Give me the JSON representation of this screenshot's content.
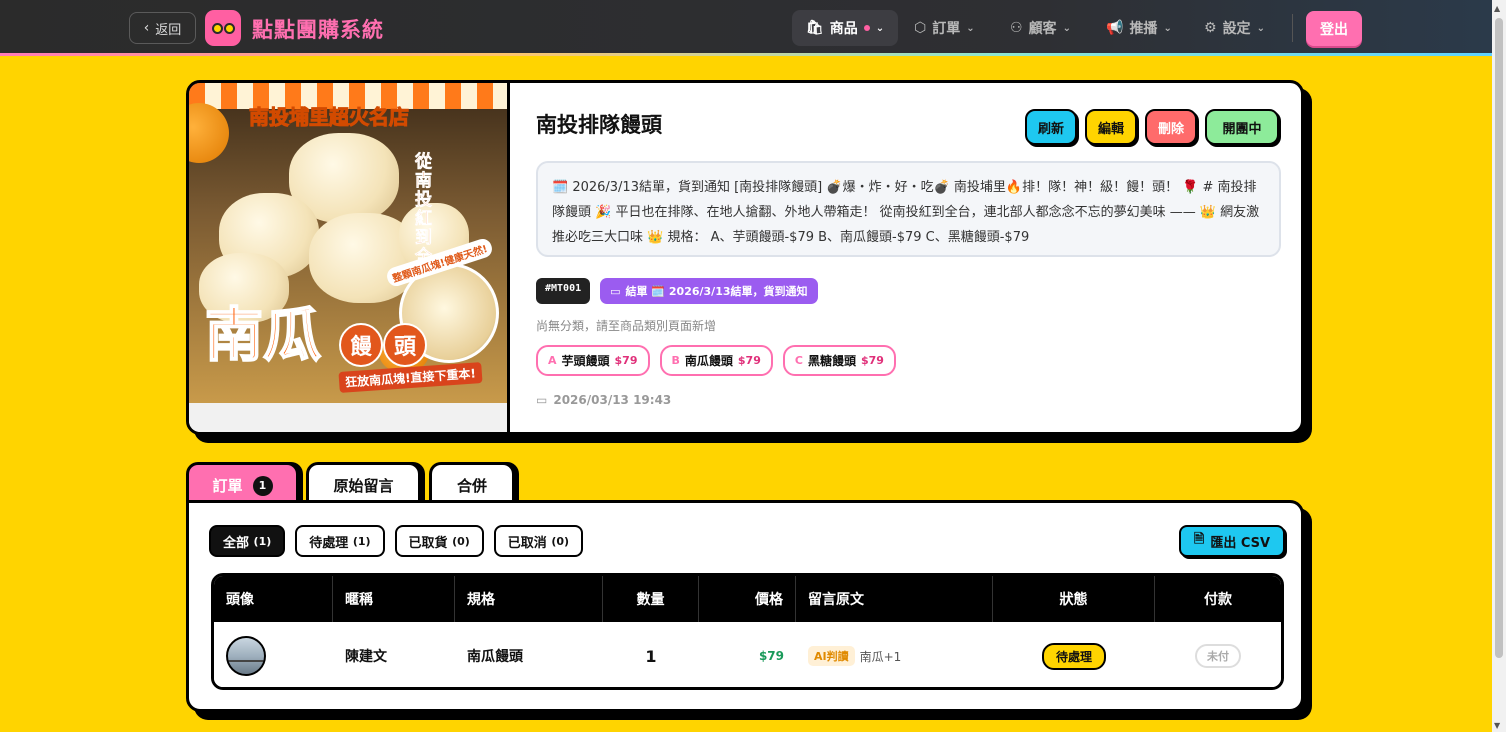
{
  "header": {
    "back_label": "返回",
    "app_title": "點點團購系統",
    "nav": [
      {
        "label": "商品",
        "icon": "bag-icon"
      },
      {
        "label": "訂單",
        "icon": "box-icon"
      },
      {
        "label": "顧客",
        "icon": "users-icon"
      },
      {
        "label": "推播",
        "icon": "megaphone-icon"
      },
      {
        "label": "設定",
        "icon": "gear-icon"
      }
    ],
    "logout_label": "登出"
  },
  "product": {
    "name": "南投排隊饅頭",
    "buttons": {
      "refresh": "刷新",
      "edit": "編輯",
      "delete": "刪除",
      "status": "開團中"
    },
    "description": "🗓️ 2026/3/13結單，貨到通知 [南投排隊饅頭] 💣爆・炸・好・吃💣 南投埔里🔥排！隊！神！級！饅！頭！ 🌹 # 南投排隊饅頭 🎉 平日也在排隊、在地人搶翻、外地人帶箱走！ 從南投紅到全台，連北部人都念念不忘的夢幻美味 —— 👑 網友激推必吃三大口味 👑 規格： A、芋頭饅頭-$79 B、南瓜饅頭-$79 C、黑糖饅頭-$79",
    "code": "#MT001",
    "end_tag": "結單 🗓️ 2026/3/13結單，貨到通知",
    "no_category": "尚無分類，請至商品類別頁面新增",
    "specs": [
      {
        "letter": "A",
        "name": "芋頭饅頭",
        "price": "$79"
      },
      {
        "letter": "B",
        "name": "南瓜饅頭",
        "price": "$79"
      },
      {
        "letter": "C",
        "name": "黑糖饅頭",
        "price": "$79"
      }
    ],
    "created_at": "2026/03/13 19:43",
    "image_text": {
      "top": "南投埔里超火名店",
      "vertical": "從南投紅到全台",
      "big": "南瓜",
      "circle": [
        "饅",
        "頭"
      ],
      "ribbon": "狂放南瓜塊!直接下重本!",
      "inset_label": "整顆南瓜塊!健康天然!"
    }
  },
  "tabs": [
    {
      "label": "訂單",
      "count": "1"
    },
    {
      "label": "原始留言"
    },
    {
      "label": "合併"
    }
  ],
  "filters": [
    {
      "label": "全部",
      "count": "(1)"
    },
    {
      "label": "待處理",
      "count": "(1)"
    },
    {
      "label": "已取貨",
      "count": "(0)"
    },
    {
      "label": "已取消",
      "count": "(0)"
    }
  ],
  "export_label": "匯出 CSV",
  "table": {
    "headers": [
      "頭像",
      "暱稱",
      "規格",
      "數量",
      "價格",
      "留言原文",
      "狀態",
      "付款"
    ],
    "rows": [
      {
        "nickname": "陳建文",
        "spec": "南瓜饅頭",
        "qty": "1",
        "price": "$79",
        "ai_tag": "AI判讀",
        "comment": "南瓜+1",
        "status": "待處理",
        "payment": "未付"
      }
    ]
  },
  "colors": {
    "background": "#FFD400",
    "accent_pink": "#ff6fb0",
    "accent_cyan": "#1EC8F0",
    "purple": "#9b5cf0"
  }
}
